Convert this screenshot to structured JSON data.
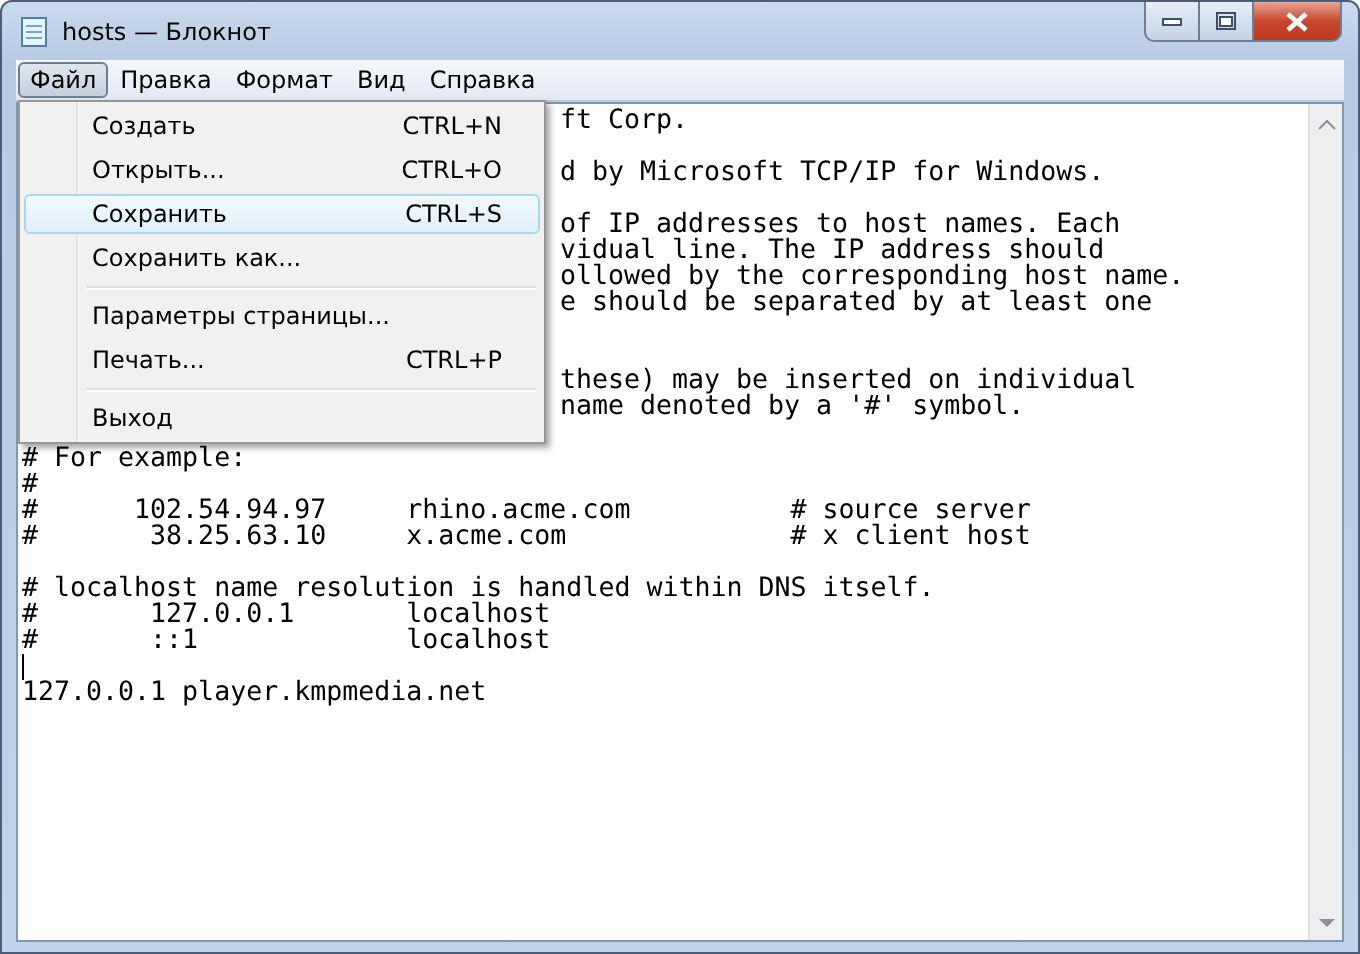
{
  "window": {
    "title": "hosts — Блокнот"
  },
  "menu_bar": [
    {
      "label": "Файл",
      "selected": true
    },
    {
      "label": "Правка",
      "selected": false
    },
    {
      "label": "Формат",
      "selected": false
    },
    {
      "label": "Вид",
      "selected": false
    },
    {
      "label": "Справка",
      "selected": false
    }
  ],
  "file_menu": {
    "items": [
      {
        "kind": "item",
        "label": "Создать",
        "shortcut": "CTRL+N",
        "selected": false
      },
      {
        "kind": "item",
        "label": "Открыть...",
        "shortcut": "CTRL+O",
        "selected": false
      },
      {
        "kind": "item",
        "label": "Сохранить",
        "shortcut": "CTRL+S",
        "selected": true
      },
      {
        "kind": "item",
        "label": "Сохранить как...",
        "selected": false
      },
      {
        "kind": "separator"
      },
      {
        "kind": "item",
        "label": "Параметры страницы...",
        "selected": false
      },
      {
        "kind": "item",
        "label": "Печать...",
        "shortcut": "CTRL+P",
        "selected": false
      },
      {
        "kind": "separator"
      },
      {
        "kind": "item",
        "label": "Выход",
        "selected": false
      }
    ]
  },
  "editor": {
    "lines": [
      {
        "kind": "partial",
        "text": "ft Corp."
      },
      {
        "kind": "blank"
      },
      {
        "kind": "partial",
        "text": "d by Microsoft TCP/IP for Windows."
      },
      {
        "kind": "blank"
      },
      {
        "kind": "partial",
        "text": "of IP addresses to host names. Each"
      },
      {
        "kind": "partial",
        "text": "vidual line. The IP address should"
      },
      {
        "kind": "partial",
        "text": "ollowed by the corresponding host name."
      },
      {
        "kind": "partial",
        "text": "e should be separated by at least one"
      },
      {
        "kind": "blank"
      },
      {
        "kind": "blank"
      },
      {
        "kind": "partial",
        "text": "these) may be inserted on individual"
      },
      {
        "kind": "partial",
        "text": "name denoted by a '#' symbol."
      },
      {
        "kind": "blank"
      },
      {
        "kind": "full",
        "text": "# For example:"
      },
      {
        "kind": "full",
        "text": "#"
      },
      {
        "kind": "full",
        "text": "#      102.54.94.97     rhino.acme.com          # source server"
      },
      {
        "kind": "full",
        "text": "#       38.25.63.10     x.acme.com              # x client host"
      },
      {
        "kind": "blank"
      },
      {
        "kind": "full",
        "text": "# localhost name resolution is handled within DNS itself."
      },
      {
        "kind": "full",
        "text": "#       127.0.0.1       localhost"
      },
      {
        "kind": "full",
        "text": "#       ::1             localhost"
      },
      {
        "kind": "cursor"
      },
      {
        "kind": "full",
        "text": "127.0.0.1 player.kmpmedia.net"
      }
    ]
  }
}
